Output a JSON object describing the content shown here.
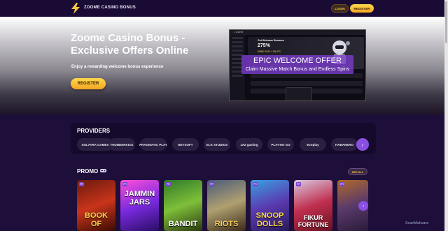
{
  "header": {
    "brand": "ZOOME CASINO BONUS",
    "login_label": "LOGIN",
    "register_label": "REGISTER"
  },
  "hero": {
    "title": "Zoome Casino Bonus - Exclusive Offers Online",
    "subtitle": "Enjoy a rewarding welcome bonus experience",
    "register_label": "REGISTER"
  },
  "screenshot": {
    "top_label": "1 zoome",
    "banner_line1": "Get Welcome Bonuses",
    "banner_line2": "275%",
    "banner_line3": "€/$5K EUR + 250 FS",
    "offer_title": "EPIC WELCOME OFFER",
    "offer_subtitle": "Claim Massive Match Bonus and Endless Spins"
  },
  "providers": {
    "heading": "PROVIDERS",
    "items": [
      "SOLATRA GAMES",
      "THUNDERKICK",
      "PRAGMATIC PLAY",
      "BETSOFT",
      "ELK STUDIOS",
      "1X2 gaming",
      "PLAYTIO GO",
      "Evoplay",
      "HABANERO"
    ],
    "next_icon": "›"
  },
  "promo": {
    "heading": "PROMO",
    "see_all_label": "SEE ALL",
    "games": [
      {
        "title": "BOOK OF",
        "tag": "PR"
      },
      {
        "title": "JAMMIN JARS",
        "tag": "PR"
      },
      {
        "title": "BANDIT",
        "tag": "PR"
      },
      {
        "title": "RIOTS",
        "tag": "PR"
      },
      {
        "title": "SNOOP DOLLS",
        "tag": "PR"
      },
      {
        "title": "FIKUR FORTUNE",
        "tag": "PR"
      },
      {
        "title": "",
        "tag": "PR"
      }
    ],
    "next_icon": "›"
  },
  "watermark": "ScanMalware",
  "colors": {
    "accent": "#f5a623",
    "purple": "#8a4fe3",
    "background": "#1e0f3a"
  }
}
